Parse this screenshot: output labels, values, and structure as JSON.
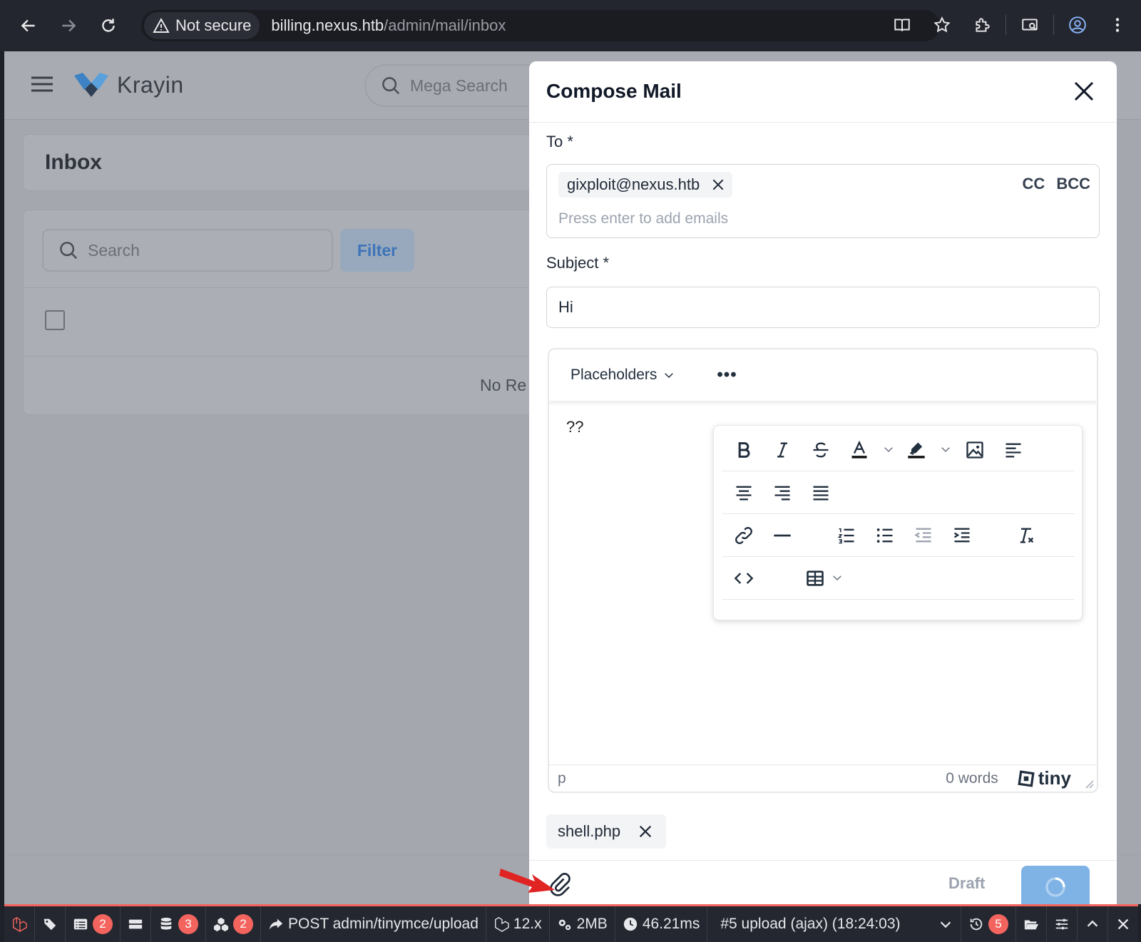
{
  "browser": {
    "security_label": "Not secure",
    "url_host": "billing.nexus.htb",
    "url_path": "/admin/mail/inbox"
  },
  "app": {
    "brand": "Krayin",
    "mega_search_placeholder": "Mega Search",
    "page_title": "Inbox",
    "search_placeholder": "Search",
    "filter_label": "Filter",
    "no_records": "No Re"
  },
  "compose": {
    "title": "Compose Mail",
    "to_label": "To *",
    "recipients": [
      "gixploit@nexus.htb"
    ],
    "cc_label": "CC",
    "bcc_label": "BCC",
    "to_placeholder": "Press enter to add emails",
    "subject_label": "Subject *",
    "subject_value": "Hi",
    "editor": {
      "placeholders_label": "Placeholders",
      "more_label": "•••",
      "content": "??",
      "status_path": "p",
      "word_count": "0 words",
      "brand": "tiny"
    },
    "attachment": "shell.php",
    "draft_label": "Draft"
  },
  "debugbar": {
    "messages_count": "2",
    "queries_count": "3",
    "models_count": "2",
    "request": "POST admin/tinymce/upload",
    "laravel_version": "12.x",
    "memory": "2MB",
    "time": "46.21ms",
    "request_history": "#5 upload (ajax) (18:24:03)",
    "history_count": "5"
  },
  "colors": {
    "accent_red": "#f4645f",
    "primary_blue": "#0e77d8",
    "overlay_gray": "#a4a7ad"
  },
  "icons": [
    "back-arrow-icon",
    "forward-arrow-icon",
    "reload-icon",
    "warning-icon",
    "reader-mode-icon",
    "star-icon",
    "extensions-icon",
    "cast-icon",
    "profile-icon",
    "kebab-menu-icon",
    "hamburger-icon",
    "search-icon",
    "close-icon",
    "chevron-down-icon",
    "bold-icon",
    "italic-icon",
    "strikethrough-icon",
    "text-color-icon",
    "highlight-icon",
    "image-icon",
    "align-left-icon",
    "align-center-icon",
    "align-right-icon",
    "justify-icon",
    "link-icon",
    "horizontal-rule-icon",
    "numbered-list-icon",
    "bullet-list-icon",
    "outdent-icon",
    "indent-icon",
    "clear-format-icon",
    "source-code-icon",
    "table-icon",
    "paperclip-icon",
    "red-arrow-icon"
  ]
}
